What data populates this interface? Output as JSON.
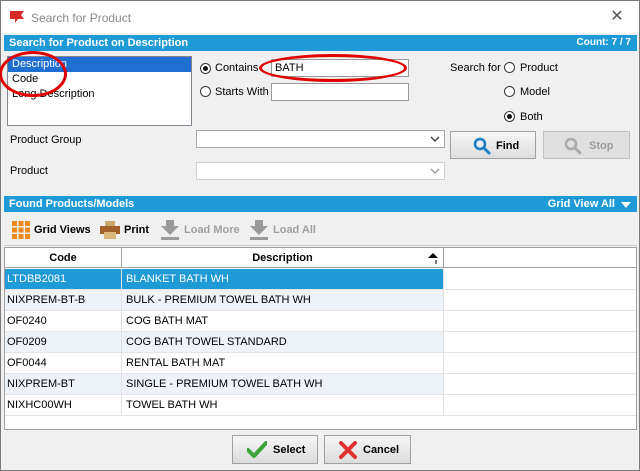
{
  "window": {
    "title": "Search for Product",
    "close_glyph": "✕"
  },
  "search_bar": {
    "title": "Search for Product on Description",
    "count": "Count: 7 / 7"
  },
  "search_fields": [
    {
      "label": "Description",
      "selected": true
    },
    {
      "label": "Code",
      "selected": false
    },
    {
      "label": "Long Description",
      "selected": false
    }
  ],
  "match": {
    "contains_label": "Contains",
    "starts_with_label": "Starts With",
    "contains_value": "BATH",
    "starts_with_value": "",
    "selected": "contains"
  },
  "search_for": {
    "label": "Search for",
    "options": [
      "Product",
      "Model",
      "Both"
    ],
    "selected": "Both"
  },
  "filters": {
    "product_group_label": "Product Group",
    "product_label": "Product",
    "product_group_value": "",
    "product_value": ""
  },
  "buttons": {
    "find": "Find",
    "stop": "Stop",
    "select": "Select",
    "cancel": "Cancel"
  },
  "found_bar": {
    "title": "Found Products/Models",
    "view": "Grid View All"
  },
  "toolbar": {
    "grid_views": "Grid Views",
    "print": "Print",
    "load_more": "Load More",
    "load_all": "Load All"
  },
  "table": {
    "headers": [
      "Code",
      "Description"
    ],
    "rows": [
      {
        "code": "LTDBB2081",
        "description": "BLANKET BATH WH"
      },
      {
        "code": "NIXPREM-BT-B",
        "description": "BULK - PREMIUM TOWEL BATH WH"
      },
      {
        "code": "OF0240",
        "description": "COG BATH MAT"
      },
      {
        "code": "OF0209",
        "description": "COG BATH TOWEL STANDARD"
      },
      {
        "code": "OF0044",
        "description": "RENTAL BATH MAT"
      },
      {
        "code": "NIXPREM-BT",
        "description": "SINGLE - PREMIUM TOWEL BATH WH"
      },
      {
        "code": "NIXHC00WH",
        "description": "TOWEL BATH WH"
      }
    ],
    "selected_row": 0
  },
  "colors": {
    "accent": "#1e9ad6",
    "annotation": "#e00000"
  }
}
